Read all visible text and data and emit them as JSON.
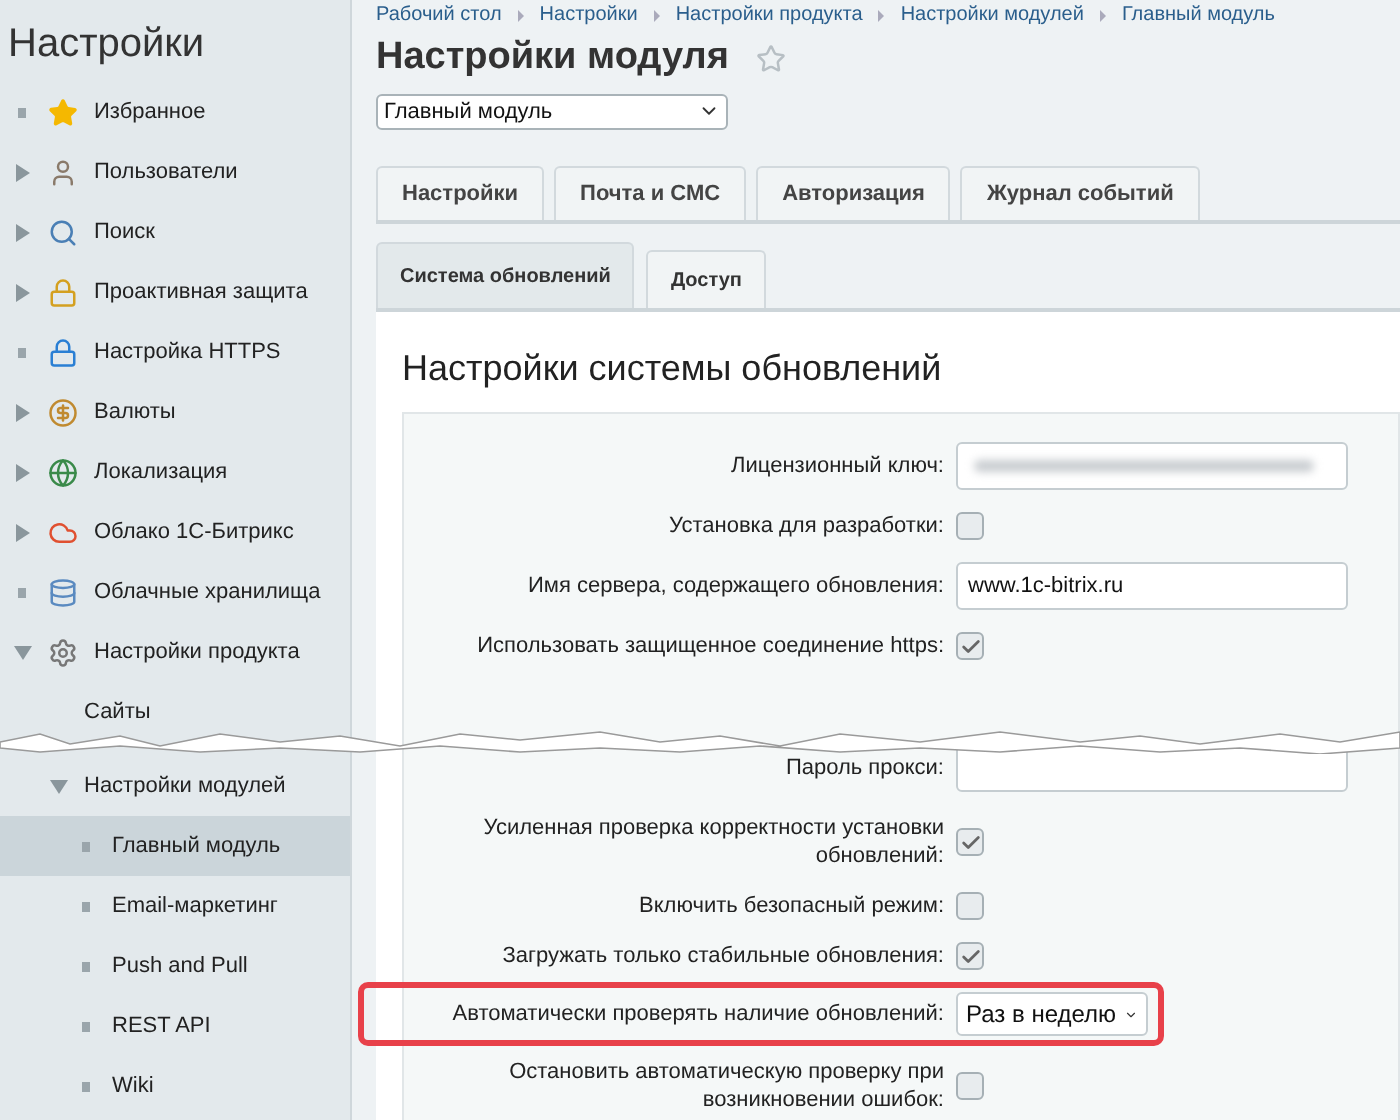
{
  "sidebar": {
    "title": "Настройки",
    "items": [
      {
        "label": "Избранное",
        "kind": "leaf",
        "selected": false
      },
      {
        "label": "Пользователи",
        "kind": "folder",
        "expanded": false,
        "selected": false
      },
      {
        "label": "Поиск",
        "kind": "folder",
        "expanded": false,
        "selected": false
      },
      {
        "label": "Проактивная защита",
        "kind": "folder",
        "expanded": false,
        "selected": false
      },
      {
        "label": "Настройка HTTPS",
        "kind": "leaf",
        "selected": false
      },
      {
        "label": "Валюты",
        "kind": "folder",
        "expanded": false,
        "selected": false
      },
      {
        "label": "Локализация",
        "kind": "folder",
        "expanded": false,
        "selected": false
      },
      {
        "label": "Облако 1С-Битрикс",
        "kind": "folder",
        "expanded": false,
        "selected": false
      },
      {
        "label": "Облачные хранилища",
        "kind": "leaf",
        "selected": false
      },
      {
        "label": "Настройки продукта",
        "kind": "folder",
        "expanded": true,
        "selected": false,
        "children": [
          {
            "label": "Сайты",
            "kind": "plain",
            "selected": false
          },
          {
            "label": "Настройки модулей",
            "kind": "folder",
            "expanded": true,
            "selected": false,
            "children": [
              {
                "label": "Главный модуль",
                "kind": "leaf",
                "selected": true
              },
              {
                "label": "Email-маркетинг",
                "kind": "leaf",
                "selected": false
              },
              {
                "label": "Push and Pull",
                "kind": "leaf",
                "selected": false
              },
              {
                "label": "REST API",
                "kind": "leaf",
                "selected": false
              },
              {
                "label": "Wiki",
                "kind": "leaf",
                "selected": false
              }
            ]
          }
        ]
      }
    ]
  },
  "breadcrumbs": [
    "Рабочий стол",
    "Настройки",
    "Настройки продукта",
    "Настройки модулей",
    "Главный модуль"
  ],
  "page_title": "Настройки модуля",
  "module_select": {
    "value": "Главный модуль"
  },
  "tabs": [
    {
      "label": "Настройки",
      "selected": false
    },
    {
      "label": "Почта и СМС",
      "selected": false
    },
    {
      "label": "Авторизация",
      "selected": false
    },
    {
      "label": "Журнал событий",
      "selected": false
    }
  ],
  "subtabs": [
    {
      "label": "Система обновлений",
      "selected": true
    },
    {
      "label": "Доступ",
      "selected": false
    }
  ],
  "section_title": "Настройки системы обновлений",
  "form_rows": [
    {
      "kind": "masked",
      "label": "Лицензионный ключ:",
      "highlighted": false
    },
    {
      "kind": "checkbox",
      "label": "Установка для разработки:",
      "checked": false,
      "highlighted": false
    },
    {
      "kind": "text",
      "label": "Имя сервера, содержащего обновления:",
      "value": "www.1c-bitrix.ru",
      "highlighted": false
    },
    {
      "kind": "checkbox",
      "label": "Использовать защищенное соединение https:",
      "checked": true,
      "highlighted": false
    },
    {
      "kind": "tear"
    },
    {
      "kind": "text",
      "label": "Пароль прокси:",
      "highlighted": false
    },
    {
      "kind": "checkbox",
      "label": "Усиленная проверка корректности установки обновлений:",
      "checked": true,
      "highlighted": false
    },
    {
      "kind": "checkbox",
      "label": "Включить безопасный режим:",
      "checked": false,
      "highlighted": false
    },
    {
      "kind": "checkbox",
      "label": "Загружать только стабильные обновления:",
      "checked": true,
      "highlighted": false
    },
    {
      "kind": "select",
      "label": "Автоматически проверять наличие обновлений:",
      "value": "Раз в неделю",
      "highlighted": true
    },
    {
      "kind": "checkbox",
      "label": "Остановить автоматическую проверку при возникновении ошибок:",
      "checked": false,
      "highlighted": false
    }
  ]
}
